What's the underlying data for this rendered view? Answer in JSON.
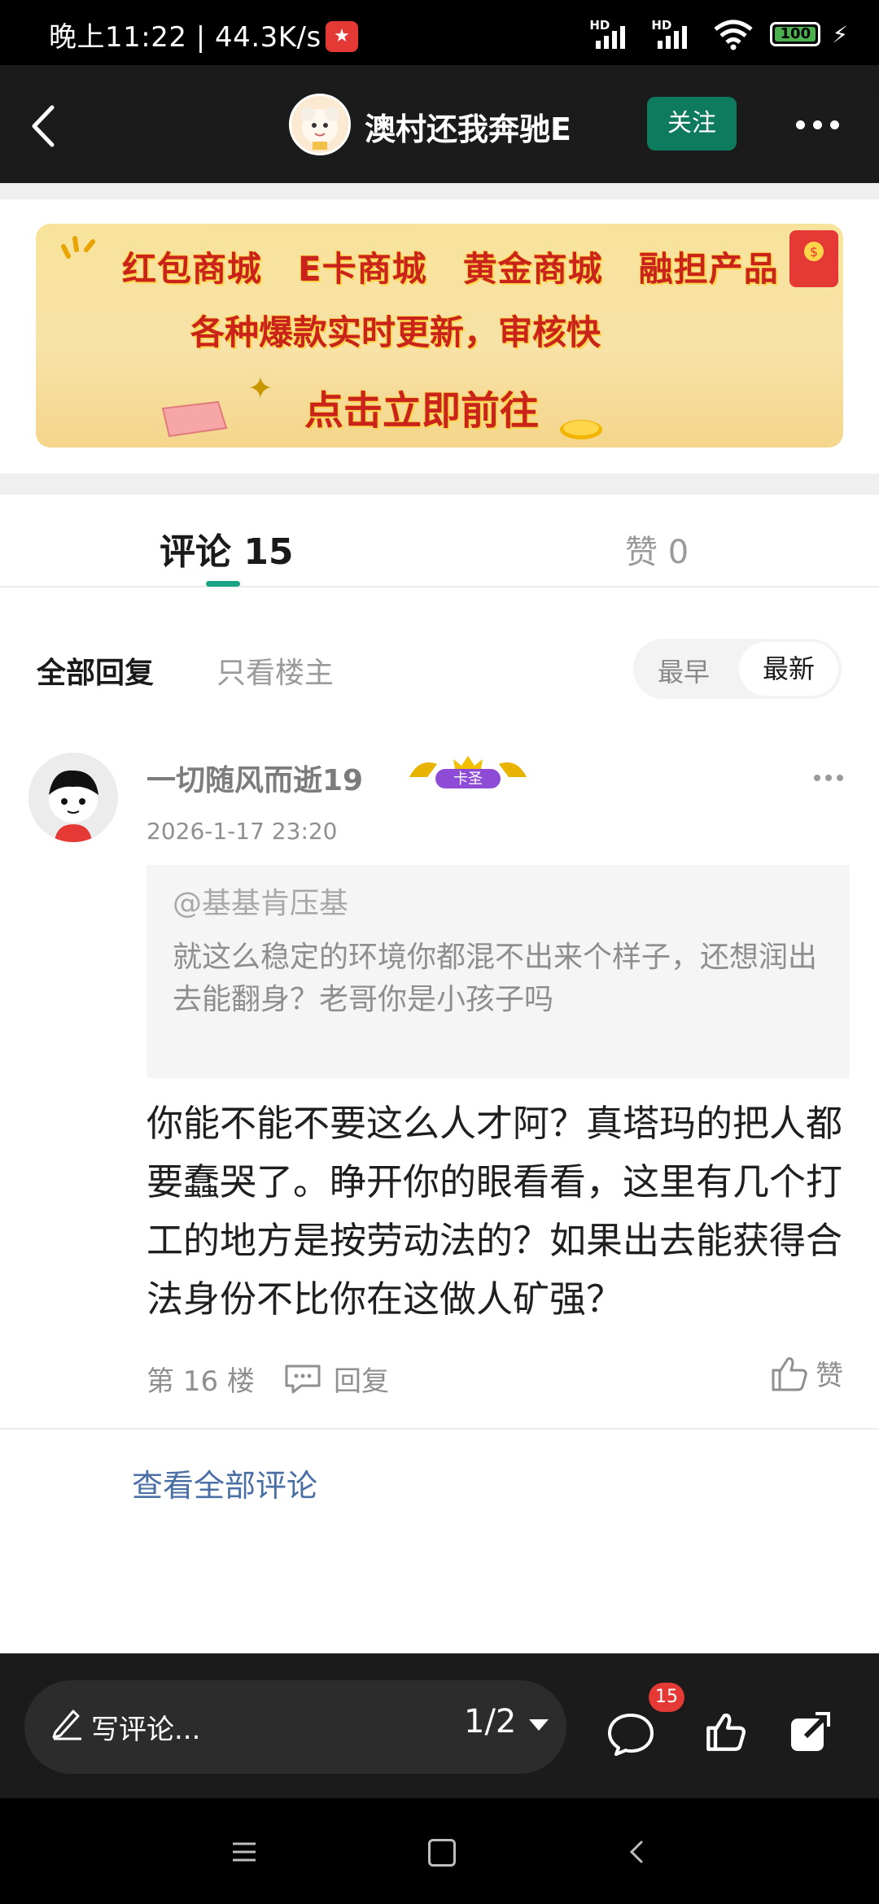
{
  "status_bar": {
    "time": "晚上11:22 | 44.3K/s",
    "network_1": "HD",
    "network_2": "HD",
    "battery": "100"
  },
  "header": {
    "author_name": "澳村还我奔驰E",
    "follow_label": "关注"
  },
  "banner": {
    "items": [
      "红包商城",
      "E卡商城",
      "黄金商城",
      "融担产品"
    ],
    "subtitle": "各种爆款实时更新，审核快",
    "cta": "点击立即前往"
  },
  "tabs": {
    "comments": "评论 15",
    "likes": "赞 0"
  },
  "filters": {
    "all": "全部回复",
    "op_only": "只看楼主",
    "sort_earliest": "最早",
    "sort_latest": "最新"
  },
  "comment": {
    "user": "一切随风而逝19",
    "badge": "卡圣",
    "time": "2026-1-17 23:20",
    "quote_user": "@基基肯压基",
    "quote_text": "就这么稳定的环境你都混不出来个样子，还想润出去能翻身？老哥你是小孩子吗",
    "body": "你能不能不要这么人才阿？真塔玛的把人都要蠢哭了。睁开你的眼看看，这里有几个打工的地方是按劳动法的？如果出去能获得合法身份不比你在这做人矿强？",
    "floor": "第 16 楼",
    "reply_label": "回复",
    "like_label": "赞"
  },
  "view_all": "查看全部评论",
  "bottom_bar": {
    "comment_placeholder": "写评论...",
    "page_indicator": "1/2",
    "comment_count": "15"
  },
  "colors": {
    "accent_green": "#0f7b5e",
    "tab_indicator": "#1aa284",
    "link_blue": "#4a6fa5",
    "badge_red": "#e53935"
  }
}
